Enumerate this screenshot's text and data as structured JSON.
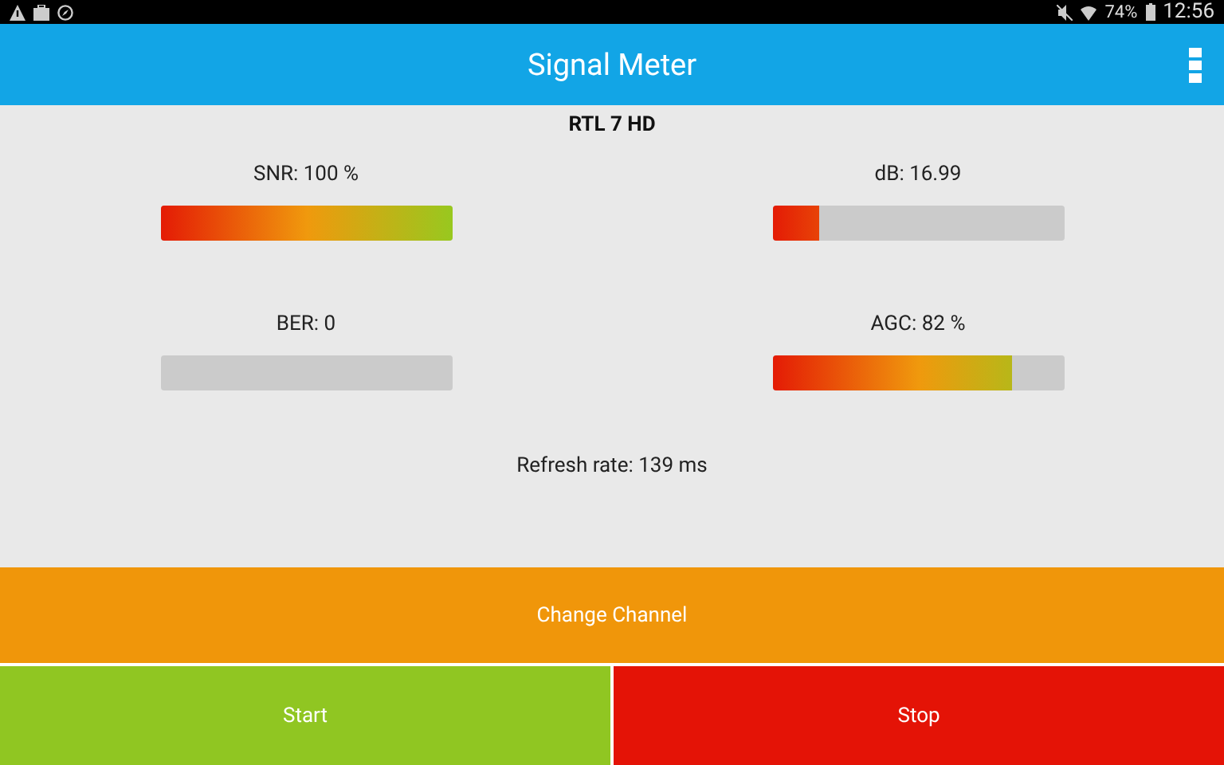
{
  "status_bar": {
    "battery": "74%",
    "time": "12:56"
  },
  "app_bar": {
    "title": "Signal Meter"
  },
  "channel": "RTL 7 HD",
  "meters": [
    {
      "label": "SNR: 100 %",
      "level": 1.0
    },
    {
      "label": "dB: 16.99",
      "level": 0.16
    },
    {
      "label": "BER: 0",
      "level": 0
    },
    {
      "label": "AGC: 82 %",
      "level": 0.82
    }
  ],
  "refresh_rate": "Refresh rate: 139 ms",
  "buttons": [
    {
      "label": "Change Channel",
      "kind": "change"
    },
    {
      "label": "Start",
      "kind": "start"
    },
    {
      "label": "Stop",
      "kind": "stop"
    }
  ]
}
